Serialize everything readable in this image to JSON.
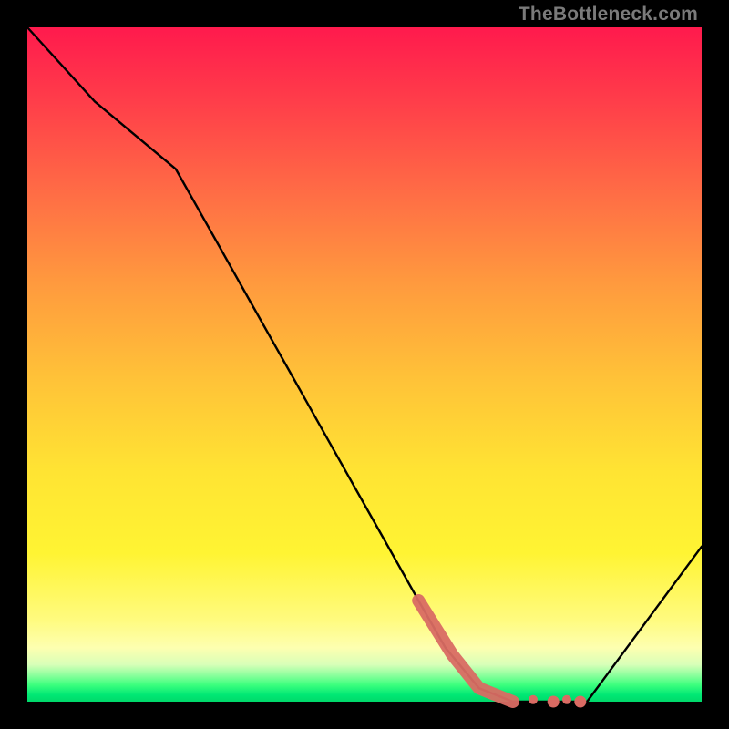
{
  "attribution": "TheBottleneck.com",
  "chart_data": {
    "type": "line",
    "title": "",
    "xlabel": "",
    "ylabel": "",
    "x_range": [
      0,
      100
    ],
    "y_range": [
      0,
      100
    ],
    "line": {
      "x": [
        0,
        10,
        22,
        58,
        67,
        72,
        78,
        83,
        100
      ],
      "y": [
        100,
        89,
        79,
        15,
        2,
        0,
        0,
        0,
        23
      ]
    },
    "highlight_segment": {
      "comment": "thick salmon stroke on the descending limb near the trough",
      "x": [
        58,
        63,
        67,
        70,
        72,
        75,
        78,
        80,
        82
      ],
      "y": [
        15,
        7,
        2,
        0.8,
        0,
        0.3,
        0,
        0.3,
        0
      ]
    },
    "gradient_stops": [
      {
        "pos": 0.0,
        "color": "#ff1a4d"
      },
      {
        "pos": 0.25,
        "color": "#ff6e45"
      },
      {
        "pos": 0.52,
        "color": "#ffc238"
      },
      {
        "pos": 0.78,
        "color": "#fff433"
      },
      {
        "pos": 0.92,
        "color": "#fdffb0"
      },
      {
        "pos": 0.97,
        "color": "#3dff7e"
      },
      {
        "pos": 1.0,
        "color": "#00d86a"
      }
    ]
  }
}
